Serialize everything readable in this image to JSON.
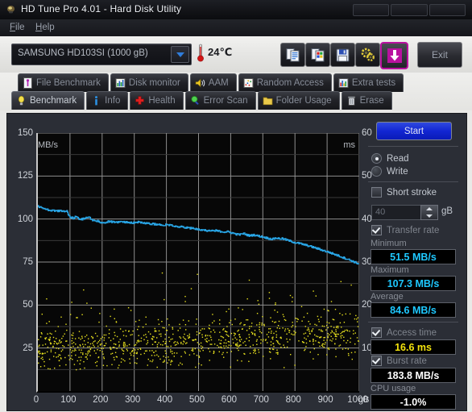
{
  "window": {
    "title": "HD Tune Pro 4.01 - Hard Disk Utility",
    "icon": "hdtune-lightbulb-icon",
    "controls": [
      "minimize",
      "maximize",
      "close"
    ]
  },
  "menu": {
    "items": [
      {
        "label": "File"
      },
      {
        "label": "Help"
      }
    ]
  },
  "toolbar": {
    "drive": {
      "value": "SAMSUNG HD103SI (1000 gB)",
      "icon": "chevron-down-icon"
    },
    "temperature": {
      "value": "24℃",
      "icon": "thermometer-icon"
    },
    "buttons": [
      {
        "name": "copy-button",
        "icon": "copy-document-icon"
      },
      {
        "name": "screenshot-button",
        "icon": "image-document-icon"
      },
      {
        "name": "save-button",
        "icon": "floppy-disk-icon"
      },
      {
        "name": "settings-button",
        "icon": "gears-icon"
      },
      {
        "name": "download-button",
        "icon": "down-arrow-icon"
      }
    ],
    "exit_label": "Exit"
  },
  "tabs": {
    "row1": [
      {
        "label": "File Benchmark",
        "icon": "file-benchmark-icon",
        "selected": false
      },
      {
        "label": "Disk monitor",
        "icon": "bar-chart-icon",
        "selected": false
      },
      {
        "label": "AAM",
        "icon": "speaker-icon",
        "selected": false
      },
      {
        "label": "Random Access",
        "icon": "scatter-icon",
        "selected": false
      },
      {
        "label": "Extra tests",
        "icon": "chart-icon",
        "selected": false
      }
    ],
    "row2": [
      {
        "label": "Benchmark",
        "icon": "lightbulb-icon",
        "selected": true
      },
      {
        "label": "Info",
        "icon": "info-icon",
        "selected": false
      },
      {
        "label": "Health",
        "icon": "red-cross-icon",
        "selected": false
      },
      {
        "label": "Error Scan",
        "icon": "magnifier-icon",
        "selected": false
      },
      {
        "label": "Folder Usage",
        "icon": "folder-icon",
        "selected": false
      },
      {
        "label": "Erase",
        "icon": "trash-icon",
        "selected": false
      }
    ]
  },
  "sidebar": {
    "start_label": "Start",
    "mode": {
      "read_label": "Read",
      "write_label": "Write",
      "selected": "Read"
    },
    "short_stroke": {
      "label": "Short stroke",
      "checked": false,
      "value": "40",
      "unit": "gB"
    },
    "transfer_rate": {
      "label": "Transfer rate",
      "checked": true
    },
    "stats": [
      {
        "label": "Minimum",
        "value": "51.5 MB/s",
        "color": "#1ec8ff"
      },
      {
        "label": "Maximum",
        "value": "107.3 MB/s",
        "color": "#1ec8ff"
      },
      {
        "label": "Average",
        "value": "84.6 MB/s",
        "color": "#1ec8ff"
      }
    ],
    "access_time": {
      "label": "Access time",
      "checked": true,
      "value": "16.6 ms",
      "color": "#f4e30c"
    },
    "burst_rate": {
      "label": "Burst rate",
      "checked": true,
      "value": "183.8 MB/s",
      "color": "#ffffff"
    },
    "cpu_usage": {
      "label": "CPU usage",
      "value": "-1.0%",
      "color": "#ffffff"
    }
  },
  "chart_data": {
    "type": "line",
    "title": "",
    "xlabel": "gB",
    "ylabel": "MB/s",
    "y2label": "ms",
    "xlim": [
      0,
      1000
    ],
    "ylim": [
      0,
      150
    ],
    "y2lim": [
      0,
      60
    ],
    "grid": true,
    "xticks": [
      0,
      100,
      200,
      300,
      400,
      500,
      600,
      700,
      800,
      900,
      1000
    ],
    "yticks": [
      25,
      50,
      75,
      100,
      125,
      150
    ],
    "y2ticks": [
      10,
      20,
      30,
      40,
      50,
      60
    ],
    "series": [
      {
        "name": "Transfer rate",
        "color": "#29a7e8",
        "axis": "left",
        "unit": "MB/s",
        "x": [
          0,
          10,
          20,
          30,
          40,
          50,
          60,
          70,
          80,
          90,
          100,
          110,
          120,
          130,
          140,
          150,
          160,
          170,
          180,
          190,
          200,
          210,
          220,
          230,
          240,
          250,
          260,
          270,
          280,
          290,
          300,
          310,
          320,
          330,
          340,
          350,
          360,
          370,
          380,
          390,
          400,
          410,
          420,
          430,
          440,
          450,
          460,
          470,
          480,
          490,
          500,
          510,
          520,
          530,
          540,
          550,
          560,
          570,
          580,
          590,
          600,
          610,
          620,
          630,
          640,
          650,
          660,
          670,
          680,
          690,
          700,
          710,
          720,
          730,
          740,
          750,
          760,
          770,
          780,
          790,
          800,
          810,
          820,
          830,
          840,
          850,
          860,
          870,
          880,
          890,
          900,
          910,
          920,
          930,
          940,
          950,
          960,
          970,
          980,
          990,
          1000
        ],
        "y": [
          107.3,
          106.6,
          105.9,
          105.4,
          105.1,
          104.9,
          104.8,
          104.6,
          104.5,
          104.4,
          101.0,
          100.4,
          101.9,
          99.6,
          100.1,
          100.8,
          101.0,
          99.4,
          98.9,
          98.7,
          97.6,
          98.2,
          98.5,
          98.4,
          98.3,
          98.2,
          98.4,
          98.3,
          98.2,
          98.0,
          97.8,
          98.3,
          98.1,
          97.6,
          97.4,
          97.2,
          97.1,
          96.9,
          96.6,
          96.5,
          96.8,
          96.6,
          96.3,
          95.8,
          95.4,
          95.5,
          95.0,
          94.6,
          94.9,
          94.4,
          94.0,
          93.8,
          93.4,
          93.2,
          93.0,
          93.4,
          93.0,
          92.8,
          92.5,
          92.6,
          92.1,
          91.6,
          91.1,
          91.0,
          91.6,
          90.8,
          90.3,
          90.8,
          90.4,
          90.0,
          89.6,
          89.1,
          88.6,
          88.3,
          89.0,
          88.6,
          88.6,
          88.1,
          87.5,
          86.9,
          86.3,
          86.0,
          85.5,
          85.0,
          84.5,
          84.0,
          83.4,
          82.8,
          82.2,
          81.6,
          81.0,
          80.4,
          79.7,
          79.0,
          78.3,
          77.6,
          76.9,
          76.2,
          75.4,
          74.6,
          73.8
        ]
      },
      {
        "name": "Access time",
        "color": "#e8e21e",
        "axis": "right",
        "unit": "ms",
        "average": 16.6,
        "scatter": true,
        "point_count": 950,
        "range_ms": [
          5,
          32
        ]
      }
    ]
  }
}
